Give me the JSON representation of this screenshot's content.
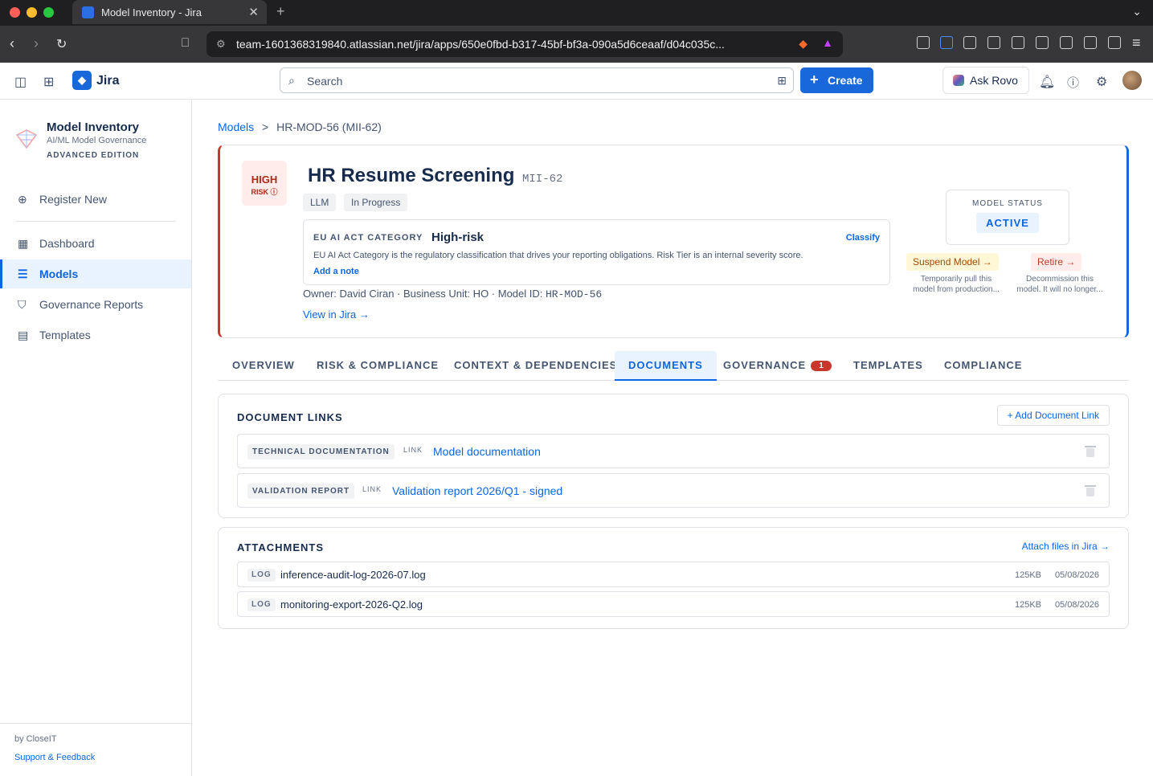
{
  "browser": {
    "tab_title": "Model Inventory - Jira",
    "url": "team-1601368319840.atlassian.net/jira/apps/650e0fbd-b317-45bf-bf3a-090a5d6ceaaf/d04c035c..."
  },
  "header": {
    "product": "Jira",
    "search_placeholder": "Search",
    "create_label": "Create",
    "ask_rovo_label": "Ask Rovo"
  },
  "sidebar": {
    "app_name": "Model Inventory",
    "app_subtitle": "AI/ML Model Governance",
    "edition": "ADVANCED EDITION",
    "register_label": "Register New",
    "items": [
      {
        "label": "Dashboard",
        "icon": "grid-icon"
      },
      {
        "label": "Models",
        "icon": "list-icon",
        "active": true
      },
      {
        "label": "Governance Reports",
        "icon": "shield-icon"
      },
      {
        "label": "Templates",
        "icon": "document-icon"
      }
    ],
    "by": "by CloseIT",
    "support": "Support & Feedback"
  },
  "breadcrumb": {
    "root": "Models",
    "separator": ">",
    "current": "HR-MOD-56 (MII-62)"
  },
  "model": {
    "risk_level": "HIGH",
    "risk_label": "RISK ⓘ",
    "name": "HR Resume Screening",
    "key": "MII-62",
    "tags": [
      "LLM",
      "In Progress"
    ],
    "eu_act_label": "EU AI ACT CATEGORY",
    "eu_act_value": "High-risk",
    "classify_label": "Classify",
    "eu_act_desc": "EU AI Act Category is the regulatory classification that drives your reporting obligations. Risk Tier is an internal severity score.",
    "add_note": "Add a note",
    "owner_text": "Owner: David Ciran · Business Unit: HO · Model ID: ",
    "model_id": "HR-MOD-56",
    "view_in_jira": "View in Jira →",
    "status_label": "MODEL STATUS",
    "status_value": "ACTIVE",
    "suspend_label": "Suspend Model →",
    "suspend_hint_1": "Temporarily pull this",
    "suspend_hint_2": "model from production...",
    "retire_label": "Retire →",
    "retire_hint_1": "Decommission this",
    "retire_hint_2": "model. It will no longer..."
  },
  "tabs": [
    {
      "label": "OVERVIEW"
    },
    {
      "label": "RISK & COMPLIANCE"
    },
    {
      "label": "CONTEXT & DEPENDENCIES"
    },
    {
      "label": "DOCUMENTS",
      "active": true
    },
    {
      "label": "GOVERNANCE",
      "badge": "1"
    },
    {
      "label": "TEMPLATES"
    },
    {
      "label": "COMPLIANCE"
    }
  ],
  "documents": {
    "heading": "DOCUMENT LINKS",
    "add_label": "+ Add Document Link",
    "rows": [
      {
        "type": "TECHNICAL DOCUMENTATION",
        "kind": "LINK",
        "title": "Model documentation"
      },
      {
        "type": "VALIDATION REPORT",
        "kind": "LINK",
        "title": "Validation report 2026/Q1 - signed"
      }
    ]
  },
  "attachments": {
    "heading": "ATTACHMENTS",
    "attach_label": "Attach files in Jira →",
    "rows": [
      {
        "type": "LOG",
        "name": "inference-audit-log-2026-07.log",
        "size": "125KB",
        "date": "05/08/2026"
      },
      {
        "type": "LOG",
        "name": "monitoring-export-2026-Q2.log",
        "size": "125KB",
        "date": "05/08/2026"
      }
    ]
  },
  "colors": {
    "accent": "#0c66e4",
    "danger": "#c9372c",
    "warning_bg": "#fff7d6"
  }
}
